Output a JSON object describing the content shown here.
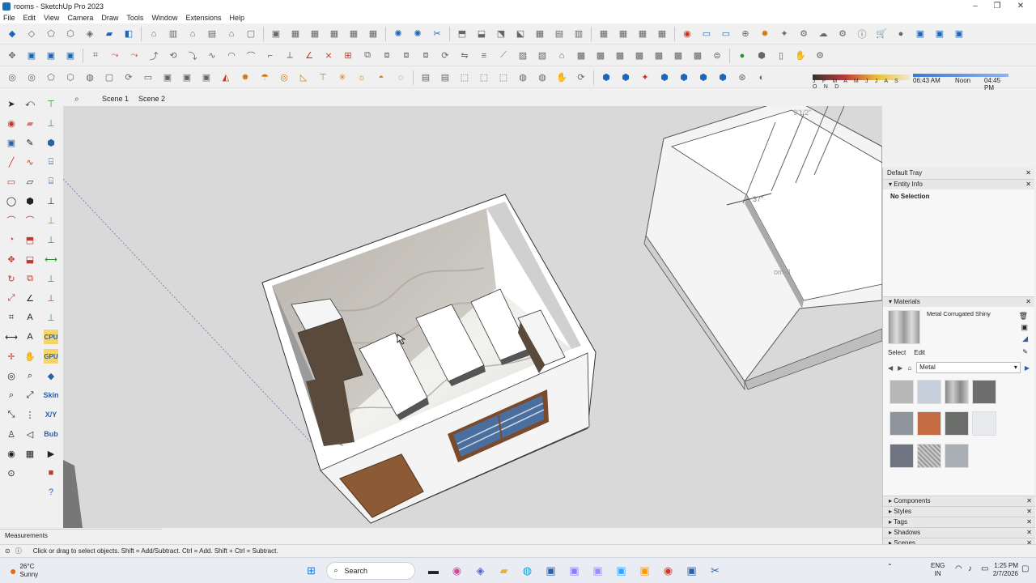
{
  "window": {
    "title": "rooms - SketchUp Pro 2023",
    "min": "–",
    "max": "❐",
    "close": "✕"
  },
  "menu": [
    "File",
    "Edit",
    "View",
    "Camera",
    "Draw",
    "Tools",
    "Window",
    "Extensions",
    "Help"
  ],
  "shadows": {
    "months": "J F M A M J J A S O N D",
    "time_start": "06:43 AM",
    "noon": "Noon",
    "time_end": "04:45 PM"
  },
  "scenes": [
    "Scene 1",
    "Scene 2"
  ],
  "left_tools": {
    "cpu": "CPU",
    "gpu": "GPU",
    "skin": "Skin",
    "xy": "X/Y",
    "bub": "Bub"
  },
  "viewport": {
    "dim1": "37\"",
    "dim2": "9'1/2\"",
    "label": "om-3"
  },
  "tray": {
    "title": "Default Tray",
    "entity_info": {
      "title": "Entity Info",
      "status": "No Selection"
    },
    "materials": {
      "title": "Materials",
      "current": "Metal Corrugated Shiny",
      "select_tab": "Select",
      "edit_tab": "Edit",
      "library": "Metal",
      "swatches": [
        "#b8b8b8",
        "#c7d0da",
        "#9c9c9c",
        "#6d6d6d",
        "#8e949b",
        "#c56b44",
        "#6b6d6b",
        "#e8eaee",
        "#6e7480",
        "#b0b0b0",
        "#a9afb5"
      ]
    },
    "sections": [
      "Components",
      "Styles",
      "Tags",
      "Shadows",
      "Scenes"
    ]
  },
  "measurements_label": "Measurements",
  "status": {
    "hint": "Click or drag to select objects. Shift = Add/Subtract. Ctrl = Add. Shift + Ctrl = Subtract."
  },
  "taskbar": {
    "temp": "26°C",
    "weather": "Sunny",
    "search": "Search",
    "lang1": "ENG",
    "lang2": "IN",
    "time": "1:25 PM",
    "date": "2/7/2026"
  }
}
